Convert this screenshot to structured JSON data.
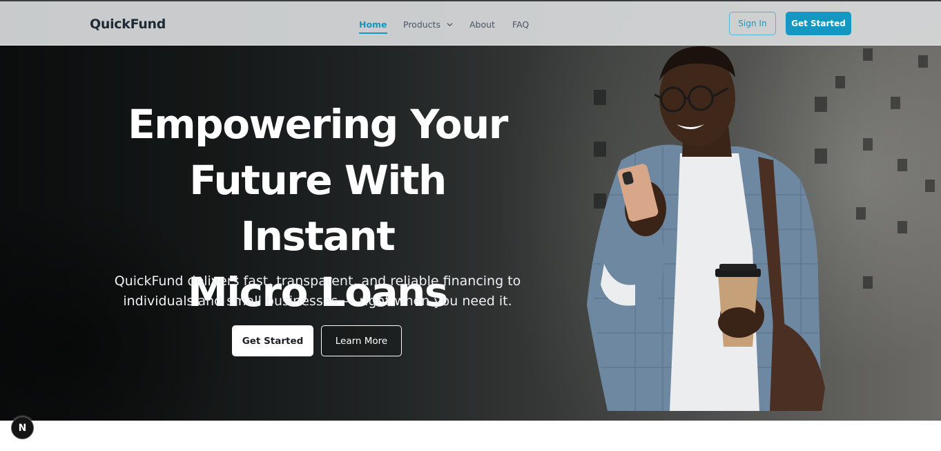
{
  "header": {
    "logo": "QuickFund",
    "nav": {
      "home": "Home",
      "products": "Products",
      "about": "About",
      "faq": "FAQ"
    },
    "sign_in": "Sign In",
    "get_started": "Get Started"
  },
  "hero": {
    "title_line1": "Empowering Your",
    "title_line2": "Future With Instant",
    "title_line3": "Micro Loans",
    "subtitle_line1": "QuickFund delivers fast, transparent, and reliable financing to",
    "subtitle_line2": "individuals and small businesses — right when you need it.",
    "primary_button": "Get Started",
    "secondary_button": "Learn More"
  },
  "badge": {
    "letter": "N"
  },
  "colors": {
    "accent": "#1497c0",
    "logo": "#1e2a36"
  }
}
